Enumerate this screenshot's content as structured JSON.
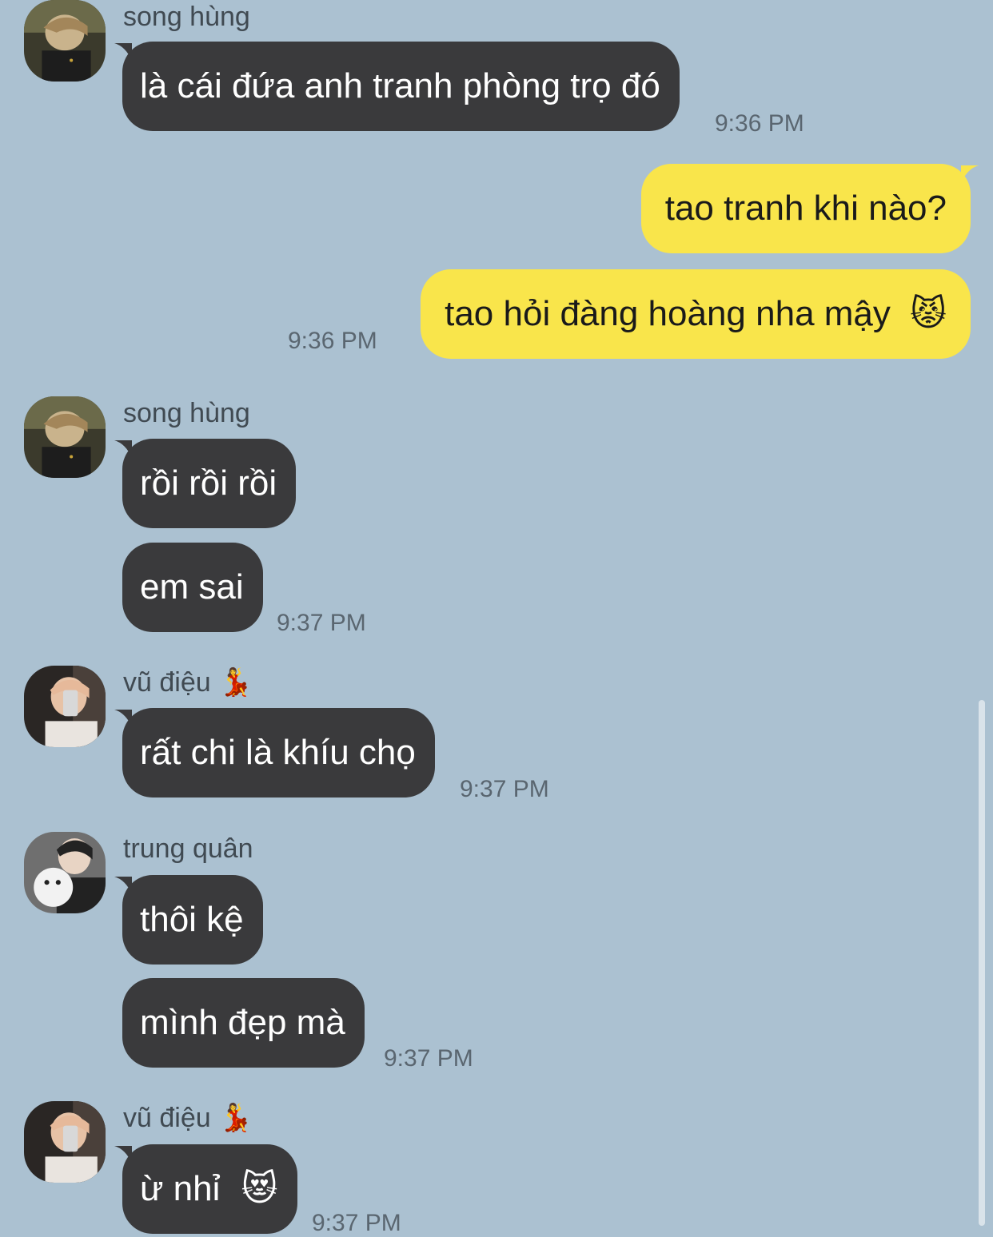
{
  "colors": {
    "background": "#abc1d1",
    "incoming_bubble": "#3a3a3c",
    "outgoing_bubble": "#f9e54b"
  },
  "messages": {
    "m1": {
      "sender": "song hùng",
      "text": "là cái đứa anh tranh phòng trọ đó",
      "time": "9:36 PM"
    },
    "m2": {
      "text": "tao tranh khi nào?"
    },
    "m3": {
      "text": "tao hỏi đàng hoàng nha mậy",
      "emoji": "😾",
      "time": "9:36 PM"
    },
    "m4": {
      "sender": "song hùng",
      "text": "rồi rồi rồi"
    },
    "m5": {
      "text": "em sai",
      "time": "9:37 PM"
    },
    "m6": {
      "sender": "vũ điệu",
      "sender_emoji": "💃",
      "text": "rất chi là khíu chọ",
      "time": "9:37 PM"
    },
    "m7": {
      "sender": "trung quân",
      "text": "thôi kệ"
    },
    "m8": {
      "text": "mình đẹp mà",
      "time": "9:37 PM"
    },
    "m9": {
      "sender": "vũ điệu",
      "sender_emoji": "💃",
      "text": "ừ nhỉ",
      "emoji": "😻",
      "time": "9:37 PM"
    }
  },
  "icons": {
    "avatar_song_hung": "profile-photo-avatar",
    "avatar_vu_dieu": "profile-photo-avatar",
    "avatar_trung_quan": "profile-photo-avatar"
  }
}
